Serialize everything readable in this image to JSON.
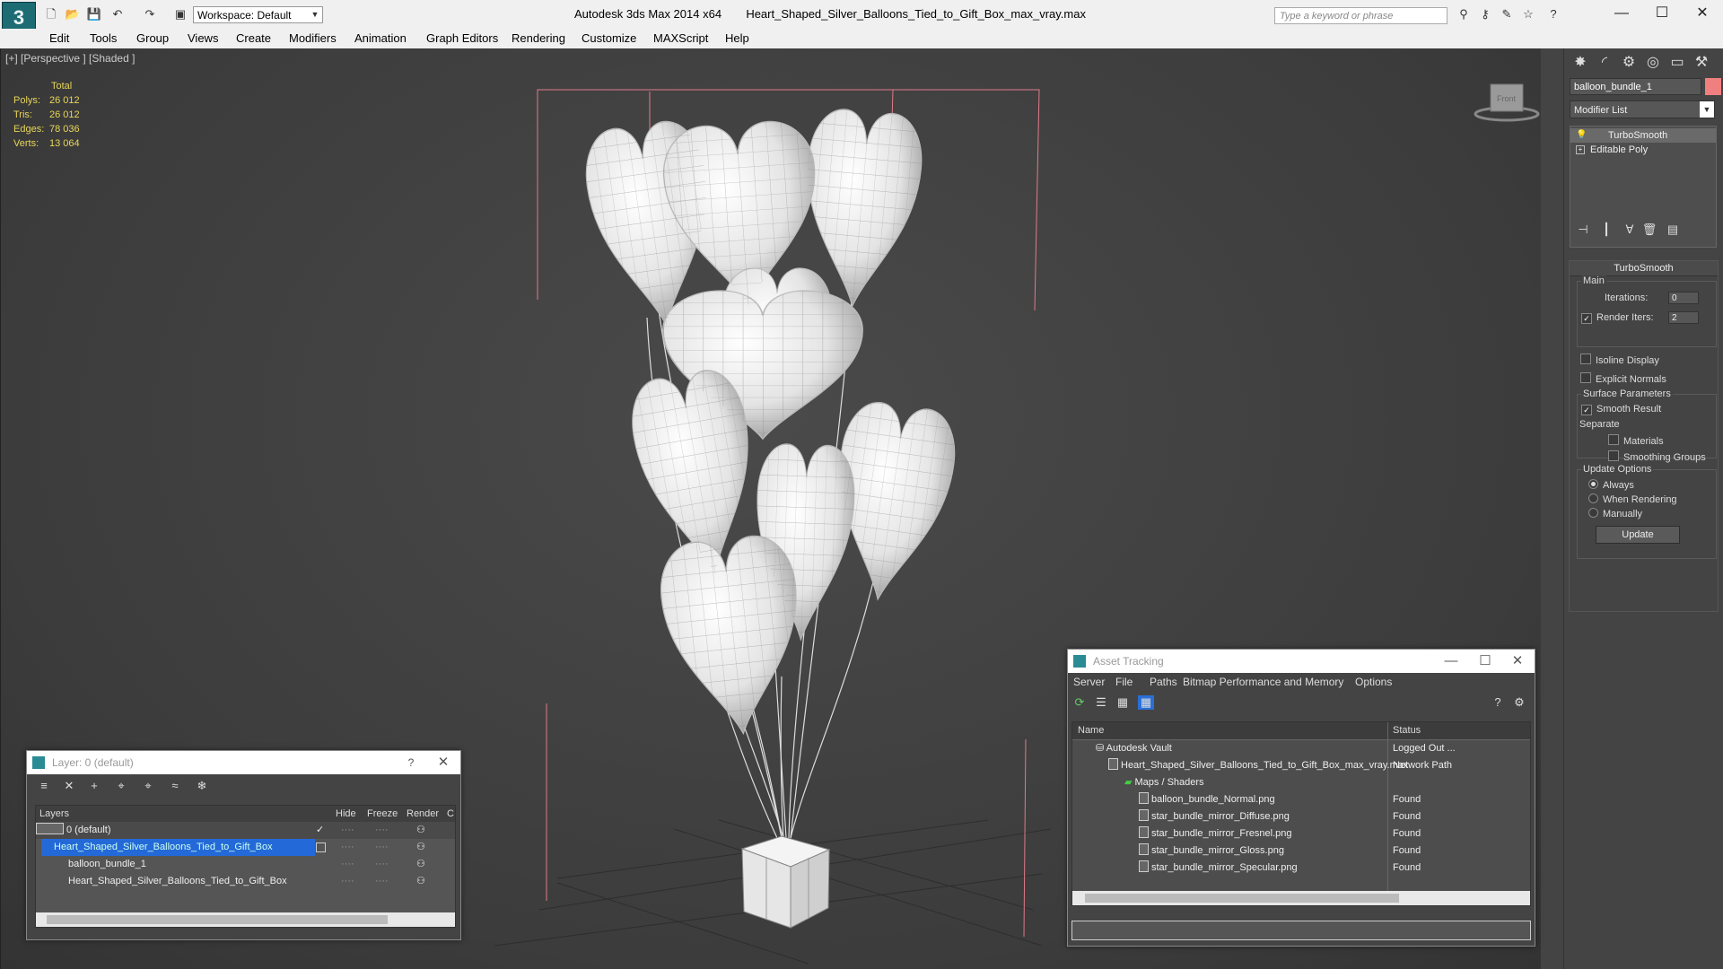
{
  "titlebar": {
    "app": "Autodesk 3ds Max  2014 x64",
    "file": "Heart_Shaped_Silver_Balloons_Tied_to_Gift_Box_max_vray.max",
    "workspace": "Workspace: Default",
    "search_placeholder": "Type a keyword or phrase"
  },
  "menu": [
    "Edit",
    "Tools",
    "Group",
    "Views",
    "Create",
    "Modifiers",
    "Animation",
    "Graph Editors",
    "Rendering",
    "Customize",
    "MAXScript",
    "Help"
  ],
  "viewport": {
    "label": "[+] [Perspective ] [Shaded ]",
    "stats_header": "Total",
    "stats": [
      {
        "label": "Polys:",
        "value": "26 012"
      },
      {
        "label": "Tris:",
        "value": "26 012"
      },
      {
        "label": "Edges:",
        "value": "78 036"
      },
      {
        "label": "Verts:",
        "value": "13 064"
      }
    ],
    "viewcube_label": "Front"
  },
  "command_panel": {
    "object_name": "balloon_bundle_1",
    "object_color": "#f08080",
    "modifier_list": "Modifier List",
    "stack": [
      "TurboSmooth",
      "Editable Poly"
    ],
    "rollout_title": "TurboSmooth",
    "main_group": "Main",
    "iterations_label": "Iterations:",
    "iterations_value": "0",
    "render_iters_label": "Render Iters:",
    "render_iters_value": "2",
    "isoline": "Isoline Display",
    "explicit_normals": "Explicit Normals",
    "surface_group": "Surface Parameters",
    "smooth_result": "Smooth Result",
    "separate": "Separate",
    "materials": "Materials",
    "smoothing_groups": "Smoothing Groups",
    "update_group": "Update Options",
    "always": "Always",
    "when_rendering": "When Rendering",
    "manually": "Manually",
    "update_button": "Update"
  },
  "layer_window": {
    "title": "Layer: 0 (default)",
    "columns": [
      "Layers",
      "Hide",
      "Freeze",
      "Render",
      "C"
    ],
    "rows": [
      {
        "name": "0 (default)",
        "indent": 1
      },
      {
        "name": "Heart_Shaped_Silver_Balloons_Tied_to_Gift_Box",
        "indent": 1
      },
      {
        "name": "balloon_bundle_1",
        "indent": 2
      },
      {
        "name": "Heart_Shaped_Silver_Balloons_Tied_to_Gift_Box",
        "indent": 2
      }
    ]
  },
  "asset_window": {
    "title": "Asset Tracking",
    "menu": [
      "Server",
      "File",
      "Paths",
      "Bitmap Performance and Memory",
      "Options"
    ],
    "columns": [
      "Name",
      "Status"
    ],
    "rows": [
      {
        "name": "Autodesk Vault",
        "status": "Logged Out ..."
      },
      {
        "name": "Heart_Shaped_Silver_Balloons_Tied_to_Gift_Box_max_vray.max",
        "status": "Network Path"
      },
      {
        "name": "Maps / Shaders",
        "status": ""
      },
      {
        "name": "balloon_bundle_Normal.png",
        "status": "Found"
      },
      {
        "name": "star_bundle_mirror_Diffuse.png",
        "status": "Found"
      },
      {
        "name": "star_bundle_mirror_Fresnel.png",
        "status": "Found"
      },
      {
        "name": "star_bundle_mirror_Gloss.png",
        "status": "Found"
      },
      {
        "name": "star_bundle_mirror_Specular.png",
        "status": "Found"
      }
    ]
  }
}
